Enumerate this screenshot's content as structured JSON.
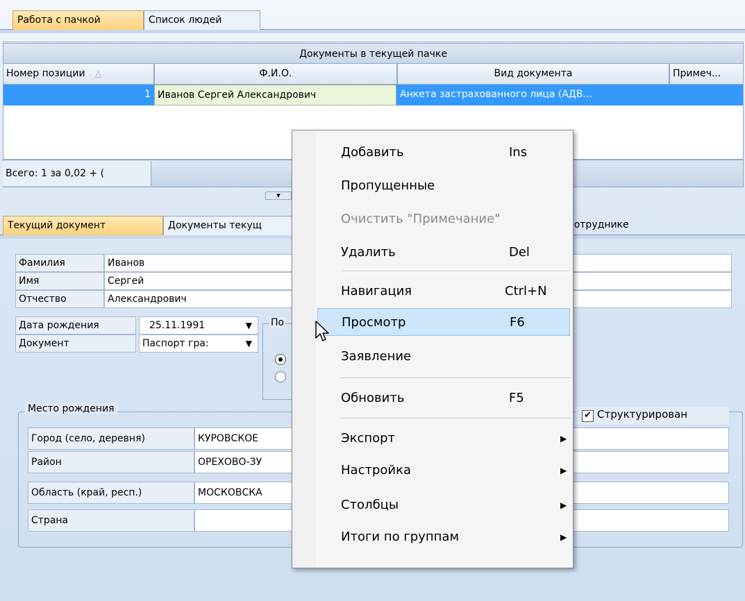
{
  "top_tabs": [
    "Работа с пачкой",
    "Список людей"
  ],
  "grid": {
    "title": "Документы в текущей пачке",
    "columns": [
      "Номер позиции",
      "Ф.И.О.",
      "Вид документа",
      "Примеч..."
    ],
    "sort_indicator": "△",
    "rows": [
      {
        "num": "1",
        "fio": "Иванов Сергей Александрович",
        "doc": "Анкета застрахованного лица (АДВ...",
        "note": ""
      }
    ],
    "footer": "Всего: 1 за 0,02 + (",
    "splitter_arrow": "▾"
  },
  "bottom_tabs": [
    "Текущий документ",
    "Документы текущ",
    "о сотруднике"
  ],
  "form": {
    "surname_label": "Фамилия",
    "surname": "Иванов",
    "name_label": "Имя",
    "name": "Сергей",
    "patronymic_label": "Отчество",
    "patronymic": "Александрович",
    "birth_label": "Дата рождения",
    "birth_date": "25.11.1991",
    "doc_label": "Документ",
    "doc_value": "Паспорт гра:",
    "gender_group_partial": "По",
    "birthplace": {
      "legend": "Место рождения",
      "structured_label": "Структурирован",
      "structured_checked": true,
      "rows": [
        {
          "label": "Город (село, деревня)",
          "value": "КУРОВСКОЕ"
        },
        {
          "label": "Район",
          "value": "ОРЕХОВО-ЗУ"
        },
        {
          "label": "Область (край, респ.)",
          "value": "МОСКОВСКА"
        },
        {
          "label": "Страна",
          "value": ""
        }
      ]
    }
  },
  "context_menu": {
    "items": [
      {
        "label": "Добавить",
        "key": "Ins"
      },
      {
        "label": "Пропущенные",
        "key": ""
      },
      {
        "label": "Очистить \"Примечание\"",
        "key": "",
        "disabled": true
      },
      {
        "label": "Удалить",
        "key": "Del"
      },
      {
        "label": "Навигация",
        "key": "Ctrl+N"
      },
      {
        "label": "Просмотр",
        "key": "F6",
        "highlighted": true
      },
      {
        "label": "Заявление",
        "key": ""
      },
      {
        "label": "Обновить",
        "key": "F5"
      },
      {
        "label": "Экспорт",
        "submenu": true
      },
      {
        "label": "Настройка",
        "submenu": true
      },
      {
        "label": "Столбцы",
        "submenu": true
      },
      {
        "label": "Итоги по группам",
        "submenu": true
      }
    ],
    "submenu_arrow": "▶"
  },
  "colors": {
    "selected_row": "#3399ff",
    "menu_highlight": "#cde6fb",
    "active_tab": "#ffd27c"
  }
}
